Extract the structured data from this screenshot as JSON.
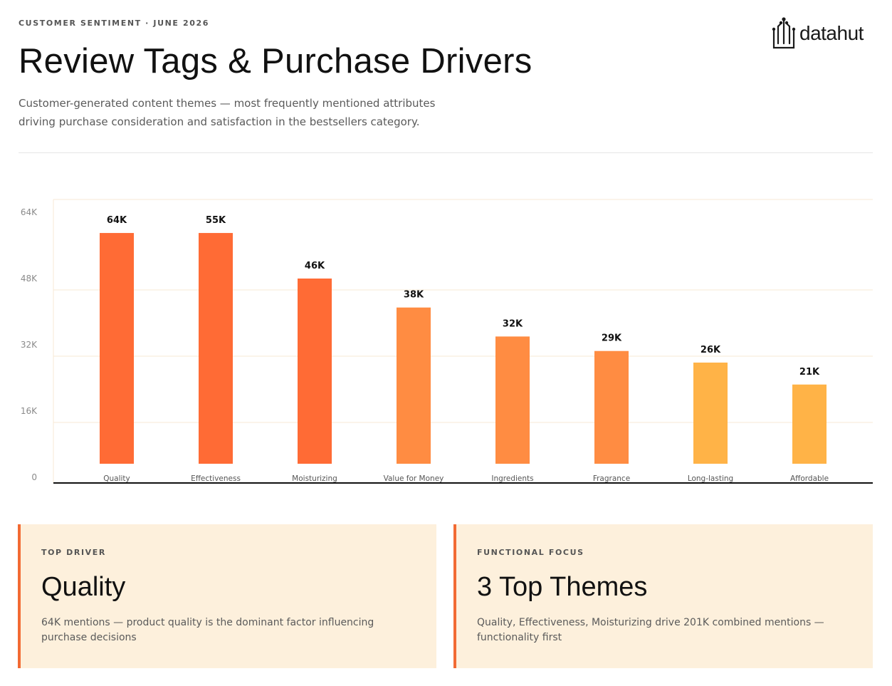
{
  "header": {
    "eyebrow": "CUSTOMER SENTIMENT · JUNE 2026",
    "title": "Review Tags & Purchase Drivers",
    "subtitle": "Customer-generated content themes — most frequently mentioned attributes driving purchase consideration and satisfaction in the bestsellers category."
  },
  "logo": {
    "word": "datahut"
  },
  "chart_data": {
    "type": "bar",
    "categories": [
      "Quality",
      "Effectiveness",
      "Moisturizing",
      "Value for Money",
      "Ingredients",
      "Fragrance",
      "Long-lasting",
      "Affordable"
    ],
    "values": [
      64,
      55,
      46,
      38,
      32,
      29,
      26,
      21
    ],
    "bar_display_values": [
      59,
      59,
      48,
      41,
      34,
      30.5,
      27.7,
      22.4
    ],
    "data_labels": [
      "64K",
      "55K",
      "46K",
      "38K",
      "32K",
      "29K",
      "26K",
      "21K"
    ],
    "ylim": [
      0,
      64
    ],
    "y_ticks": [
      0,
      16,
      32,
      48,
      64
    ],
    "y_tick_labels": [
      "0",
      "16K",
      "32K",
      "48K",
      "64K"
    ],
    "bar_colors": [
      "#ff6b35",
      "#ff6b35",
      "#ff6b35",
      "#ff8c42",
      "#ff8c42",
      "#ff8c42",
      "#ffb347",
      "#ffb347"
    ],
    "grid": true,
    "gridline_color": "#f7e9d6",
    "axis_color": "#111111"
  },
  "cards": [
    {
      "label": "TOP DRIVER",
      "title": "Quality",
      "desc": "64K mentions — product quality is the dominant factor influencing purchase decisions"
    },
    {
      "label": "FUNCTIONAL FOCUS",
      "title": "3 Top Themes",
      "desc": "Quality, Effectiveness, Moisturizing drive 201K combined mentions — functionality first"
    }
  ],
  "colors": {
    "accent": "#f26a33",
    "card_bg": "#fdf0dc"
  }
}
